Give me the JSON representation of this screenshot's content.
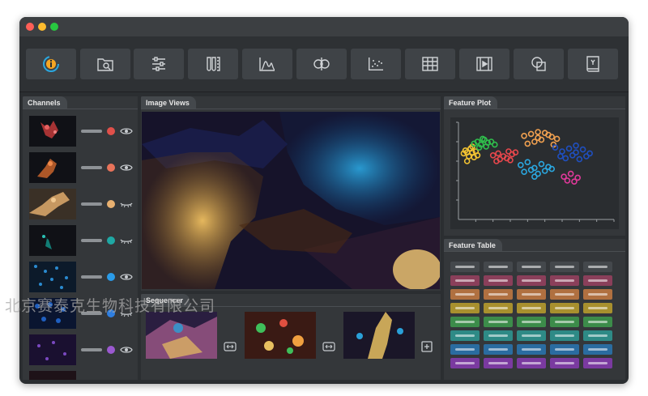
{
  "window": {
    "traffic_lights": [
      "#ff5f57",
      "#febc2e",
      "#28c840"
    ]
  },
  "toolbar": {
    "tools": [
      {
        "icon": "info-cycle-icon",
        "accent": "#f5a623"
      },
      {
        "icon": "image-search-icon"
      },
      {
        "icon": "sliders-icon"
      },
      {
        "icon": "tubes-icon"
      },
      {
        "icon": "histogram-icon"
      },
      {
        "icon": "cell-split-icon"
      },
      {
        "icon": "scatter-plot-icon"
      },
      {
        "icon": "table-icon"
      },
      {
        "icon": "film-strip-icon"
      },
      {
        "icon": "overlap-shapes-icon"
      },
      {
        "icon": "bookmark-y-icon"
      }
    ]
  },
  "channels": {
    "title": "Channels",
    "items": [
      {
        "color": "#e0504a",
        "visibility": "visible"
      },
      {
        "color": "#e8735a",
        "visibility": "visible"
      },
      {
        "color": "#e8b070",
        "visibility": "hidden"
      },
      {
        "color": "#1fa8a4",
        "visibility": "hidden"
      },
      {
        "color": "#2a9be8",
        "visibility": "visible"
      },
      {
        "color": "#2f7fe0",
        "visibility": "hidden"
      },
      {
        "color": "#9b59d0",
        "visibility": "visible"
      }
    ]
  },
  "image_views": {
    "title": "Image Views"
  },
  "sequencer": {
    "title": "Sequencer",
    "frames": 3,
    "add_icon": "plus-square-icon"
  },
  "feature_plot": {
    "title": "Feature Plot"
  },
  "chart_data": {
    "type": "scatter",
    "title": "",
    "xlabel": "",
    "ylabel": "",
    "grid": false,
    "legend": "none",
    "series": [
      {
        "color": "#f1c232",
        "x": [
          0.3,
          0.4,
          0.5,
          0.6,
          0.7,
          0.8,
          0.9,
          1.0,
          1.1,
          0.5,
          0.8
        ],
        "y": [
          6.8,
          7.1,
          6.9,
          6.5,
          7.3,
          6.9,
          6.4,
          7.0,
          6.6,
          6.0,
          7.5
        ]
      },
      {
        "color": "#2fbf4c",
        "x": [
          0.9,
          1.1,
          1.3,
          1.5,
          1.7,
          1.2,
          1.6,
          1.9,
          2.1,
          1.4
        ],
        "y": [
          7.8,
          8.0,
          7.7,
          8.2,
          7.9,
          7.4,
          7.5,
          8.0,
          7.7,
          8.3
        ]
      },
      {
        "color": "#e8474c",
        "x": [
          2.0,
          2.3,
          2.6,
          2.9,
          3.1,
          2.4,
          2.8,
          3.3,
          2.2,
          3.0
        ],
        "y": [
          6.6,
          6.8,
          6.5,
          7.0,
          6.7,
          6.2,
          6.3,
          6.9,
          6.0,
          6.1
        ]
      },
      {
        "color": "#f0a050",
        "x": [
          3.8,
          4.2,
          4.6,
          5.0,
          5.4,
          4.4,
          4.8,
          5.2,
          5.7,
          4.0,
          4.6,
          5.5
        ],
        "y": [
          8.6,
          8.8,
          8.4,
          8.9,
          8.5,
          8.0,
          8.2,
          8.7,
          8.3,
          7.8,
          9.0,
          7.7
        ]
      },
      {
        "color": "#2aa7df",
        "x": [
          3.6,
          4.0,
          4.4,
          4.8,
          5.2,
          3.8,
          4.2,
          4.6,
          5.0,
          5.4,
          4.4
        ],
        "y": [
          5.6,
          5.9,
          5.3,
          5.7,
          5.4,
          4.9,
          5.1,
          4.7,
          5.0,
          5.2,
          4.4
        ]
      },
      {
        "color": "#1f4fbf",
        "x": [
          5.6,
          6.0,
          6.4,
          6.8,
          7.2,
          7.6,
          6.2,
          6.6,
          7.0,
          7.4,
          5.9,
          6.8
        ],
        "y": [
          7.4,
          7.0,
          7.3,
          6.9,
          7.2,
          6.8,
          6.3,
          6.6,
          6.2,
          6.5,
          6.5,
          7.6
        ]
      },
      {
        "color": "#e0399a",
        "x": [
          6.1,
          6.5,
          6.9,
          6.3,
          6.7
        ],
        "y": [
          4.4,
          4.7,
          4.3,
          4.0,
          3.9
        ]
      }
    ]
  },
  "feature_table": {
    "title": "Feature Table",
    "columns": 5,
    "row_colors": [
      "#44484c",
      "#8a3f5a",
      "#b07040",
      "#a8902e",
      "#3c8c4a",
      "#2e8a86",
      "#2a6ca0",
      "#7a3aa0"
    ]
  },
  "watermark": {
    "text": "北京赛泰克生物科技有限公司"
  }
}
